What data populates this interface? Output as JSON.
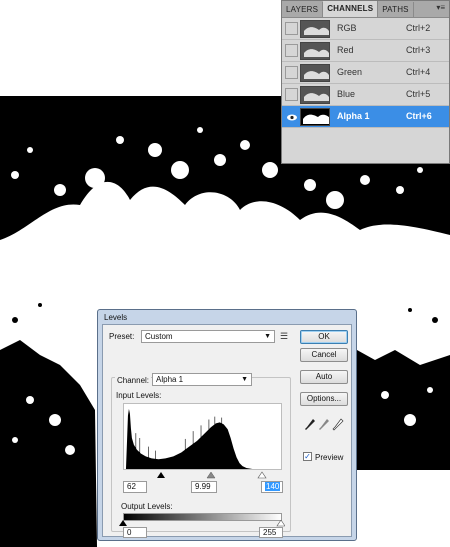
{
  "panel": {
    "tabs": [
      "LAYERS",
      "CHANNELS",
      "PATHS"
    ],
    "active_tab": "CHANNELS",
    "menu_icon": "panel-menu-icon",
    "channels": [
      {
        "name": "RGB",
        "shortcut": "Ctrl+2",
        "visible": false,
        "selected": false
      },
      {
        "name": "Red",
        "shortcut": "Ctrl+3",
        "visible": false,
        "selected": false
      },
      {
        "name": "Green",
        "shortcut": "Ctrl+4",
        "visible": false,
        "selected": false
      },
      {
        "name": "Blue",
        "shortcut": "Ctrl+5",
        "visible": false,
        "selected": false
      },
      {
        "name": "Alpha 1",
        "shortcut": "Ctrl+6",
        "visible": true,
        "selected": true
      }
    ],
    "selected_color": "#3b8ee6"
  },
  "levels": {
    "title": "Levels",
    "preset_label": "Preset:",
    "preset_value": "Custom",
    "channel_label": "Channel:",
    "channel_value": "Alpha 1",
    "input_levels_label": "Input Levels:",
    "input_black": "62",
    "input_gamma": "9.99",
    "input_white": "140",
    "output_levels_label": "Output Levels:",
    "output_black": "0",
    "output_white": "255",
    "buttons": {
      "ok": "OK",
      "cancel": "Cancel",
      "auto": "Auto",
      "options": "Options..."
    },
    "preview_label": "Preview",
    "preview_checked": true,
    "eyedroppers": [
      "black-eyedropper-icon",
      "gray-eyedropper-icon",
      "white-eyedropper-icon"
    ]
  }
}
